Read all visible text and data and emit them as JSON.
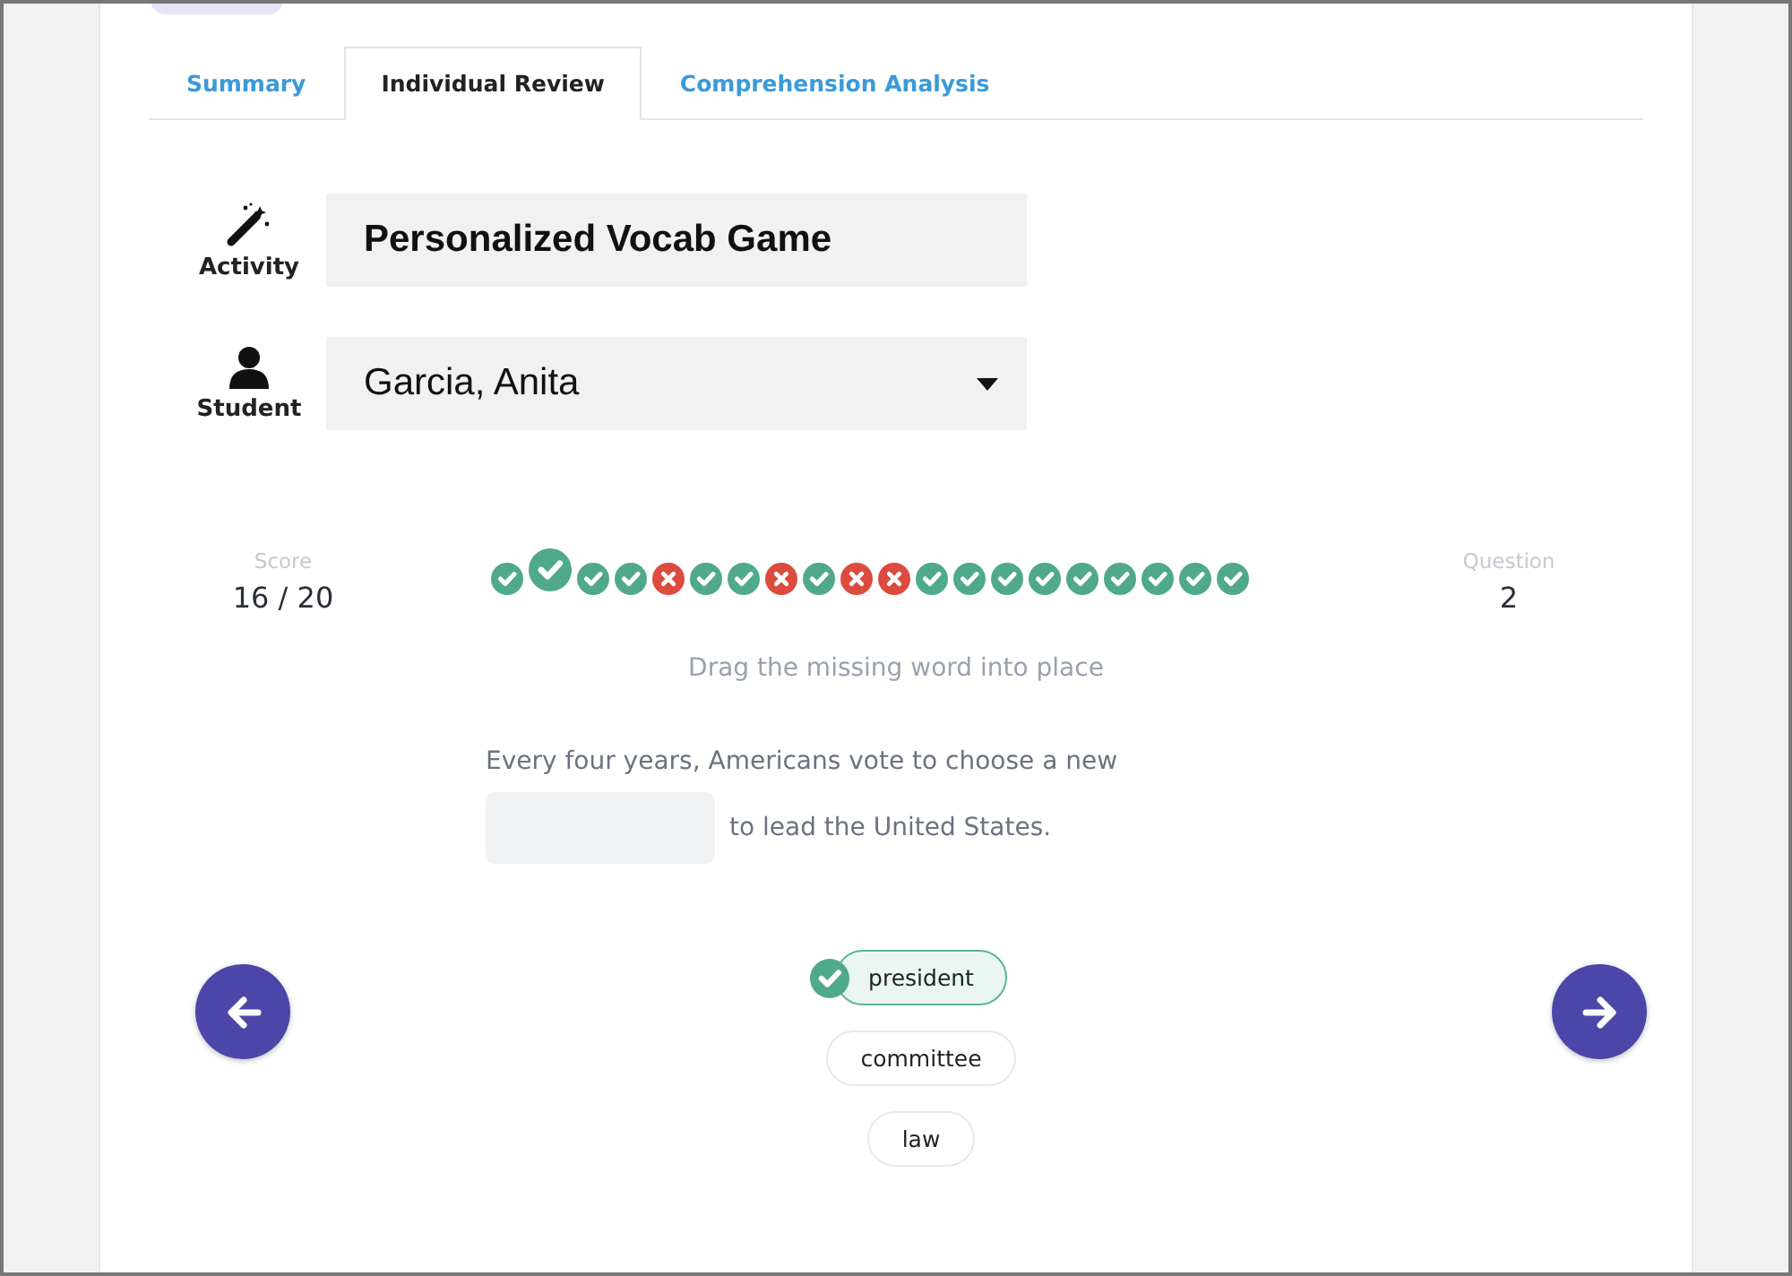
{
  "tabs": [
    {
      "label": "Summary",
      "selected": false
    },
    {
      "label": "Individual Review",
      "selected": true
    },
    {
      "label": "Comprehension Analysis",
      "selected": false
    }
  ],
  "activity": {
    "label": "Activity",
    "value": "Personalized Vocab Game"
  },
  "student": {
    "label": "Student",
    "value": "Garcia, Anita"
  },
  "score": {
    "label": "Score",
    "value": "16 / 20"
  },
  "question": {
    "label": "Question",
    "value": "2"
  },
  "results": [
    {
      "correct": true,
      "selected": false
    },
    {
      "correct": true,
      "selected": true
    },
    {
      "correct": true,
      "selected": false
    },
    {
      "correct": true,
      "selected": false
    },
    {
      "correct": false,
      "selected": false
    },
    {
      "correct": true,
      "selected": false
    },
    {
      "correct": true,
      "selected": false
    },
    {
      "correct": false,
      "selected": false
    },
    {
      "correct": true,
      "selected": false
    },
    {
      "correct": false,
      "selected": false
    },
    {
      "correct": false,
      "selected": false
    },
    {
      "correct": true,
      "selected": false
    },
    {
      "correct": true,
      "selected": false
    },
    {
      "correct": true,
      "selected": false
    },
    {
      "correct": true,
      "selected": false
    },
    {
      "correct": true,
      "selected": false
    },
    {
      "correct": true,
      "selected": false
    },
    {
      "correct": true,
      "selected": false
    },
    {
      "correct": true,
      "selected": false
    },
    {
      "correct": true,
      "selected": false
    }
  ],
  "instruction": "Drag the missing word into place",
  "sentence": {
    "before": "Every four years, Americans vote to choose a new",
    "after": "to lead the United States."
  },
  "choices": [
    {
      "label": "president",
      "selected": true
    },
    {
      "label": "committee",
      "selected": false
    },
    {
      "label": "law",
      "selected": false
    }
  ]
}
